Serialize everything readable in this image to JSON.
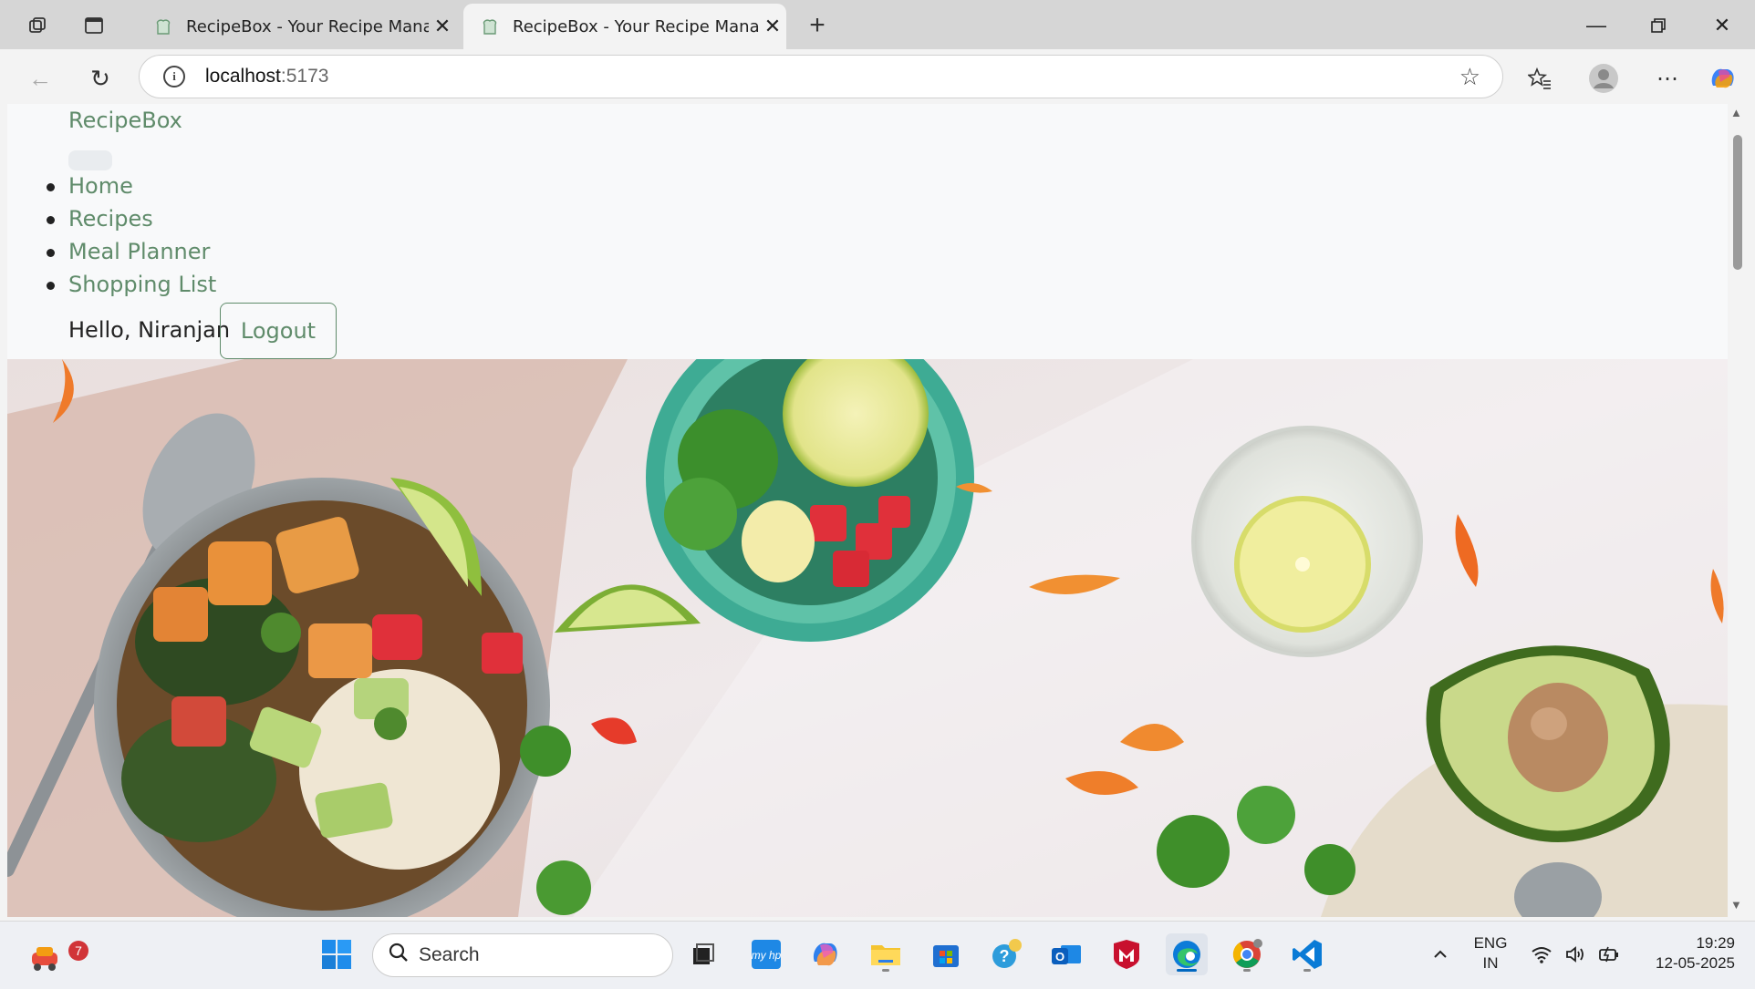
{
  "browser": {
    "tabs": [
      {
        "title": "RecipeBox - Your Recipe Manager",
        "active": false
      },
      {
        "title": "RecipeBox - Your Recipe Manager",
        "active": true
      }
    ],
    "address": {
      "host": "localhost",
      "port": ":5173"
    }
  },
  "site": {
    "brand": "RecipeBox",
    "nav": {
      "home": "Home",
      "recipes": "Recipes",
      "meal_planner": "Meal Planner",
      "shopping_list": "Shopping List"
    },
    "greeting": "Hello, Niranjan",
    "logout_label": "Logout"
  },
  "taskbar": {
    "search_placeholder": "Search",
    "notification_count": "7",
    "language": "ENG",
    "region": "IN",
    "time": "19:29",
    "date": "12-05-2025"
  },
  "colors": {
    "accent": "#5f8b6a",
    "tab_strip": "#d6d6d6",
    "header_bg": "#f8f9fa"
  }
}
